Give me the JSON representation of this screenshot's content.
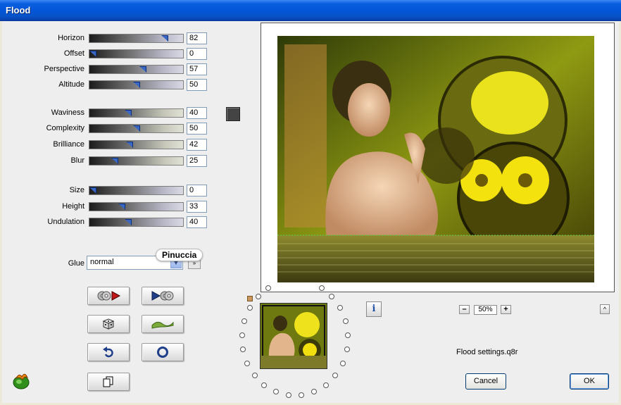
{
  "window": {
    "title": "Flood"
  },
  "sliders": [
    {
      "id": "horizon",
      "label": "Horizon",
      "value": "82",
      "level": 0.82,
      "style": "blue"
    },
    {
      "id": "offset",
      "label": "Offset",
      "value": "0",
      "level": 0.0,
      "style": "blue"
    },
    {
      "id": "perspective",
      "label": "Perspective",
      "value": "57",
      "level": 0.57,
      "style": "blue"
    },
    {
      "id": "altitude",
      "label": "Altitude",
      "value": "50",
      "level": 0.5,
      "style": "blue"
    },
    {
      "id": "waviness",
      "label": "Waviness",
      "value": "40",
      "level": 0.4,
      "style": "khaki"
    },
    {
      "id": "complexity",
      "label": "Complexity",
      "value": "50",
      "level": 0.5,
      "style": "khaki"
    },
    {
      "id": "brilliance",
      "label": "Brilliance",
      "value": "42",
      "level": 0.42,
      "style": "khaki"
    },
    {
      "id": "blur",
      "label": "Blur",
      "value": "25",
      "level": 0.25,
      "style": "khaki"
    },
    {
      "id": "size",
      "label": "Size",
      "value": "0",
      "level": 0.0,
      "style": "blue"
    },
    {
      "id": "height",
      "label": "Height",
      "value": "33",
      "level": 0.33,
      "style": "blue"
    },
    {
      "id": "undulation",
      "label": "Undulation",
      "value": "40",
      "level": 0.4,
      "style": "blue"
    }
  ],
  "glue": {
    "label": "Glue",
    "value": "normal"
  },
  "watermark": "Pinuccia",
  "color_swatch": "#444444",
  "tool_buttons": [
    {
      "name": "random-stop-icon"
    },
    {
      "name": "play-forward-icon"
    },
    {
      "name": "dice-icon"
    },
    {
      "name": "wave-icon"
    },
    {
      "name": "undo-icon"
    },
    {
      "name": "reset-circle-icon"
    },
    {
      "name": "copy-icon"
    }
  ],
  "zoom": {
    "value": "50%",
    "minus": "–",
    "plus": "+"
  },
  "info_label": "i",
  "collapse_label": "^",
  "settings_file": "Flood settings.q8r",
  "buttons": {
    "cancel": "Cancel",
    "ok": "OK"
  }
}
